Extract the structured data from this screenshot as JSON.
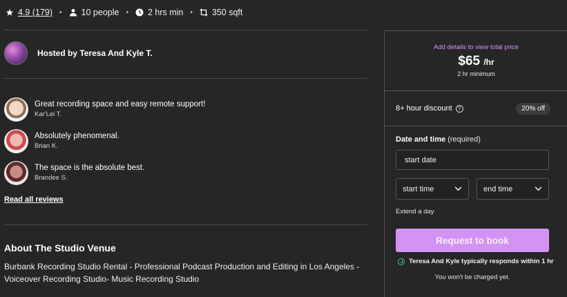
{
  "stats": {
    "rating": "4.9 (179)",
    "people": "10 people",
    "duration": "2 hrs min",
    "area": "350 sqft",
    "icons": [
      "star-icon",
      "person-icon",
      "clock-icon",
      "area-icon"
    ]
  },
  "host": {
    "label": "Hosted by Teresa And Kyle T."
  },
  "reviews": [
    {
      "quote": "Great recording space and easy remote support!",
      "author": "Kar'Lei T."
    },
    {
      "quote": "Absolutely phenomenal.",
      "author": "Brian K."
    },
    {
      "quote": "The space is the absolute best.",
      "author": "Brandee S."
    }
  ],
  "read_all": "Read all reviews",
  "about": {
    "title": "About The Studio Venue",
    "description": "Burbank Recording Studio Rental - Professional Podcast Production and Editing in Los Angeles - Voiceover Recording Studio- Music Recording Studio"
  },
  "booking": {
    "details_link": "Add details to view total price",
    "price": "$65",
    "price_unit": "/hr",
    "minimum": "2 hr minimum",
    "discount_label": "8+ hour discount",
    "discount_badge": "20% off",
    "date_time_label": "Date and time",
    "date_time_required": "(required)",
    "start_date": "start date",
    "start_time": "start time",
    "end_time": "end time",
    "extend": "Extend a day",
    "request_button": "Request to book",
    "responds": "Teresa And Kyle typically responds within 1 hr",
    "no_charge": "You won't be charged yet."
  },
  "colors": {
    "background": "#262626",
    "accent": "#d493f3",
    "link_accent": "#d794ff",
    "success": "#3ecf8e"
  }
}
